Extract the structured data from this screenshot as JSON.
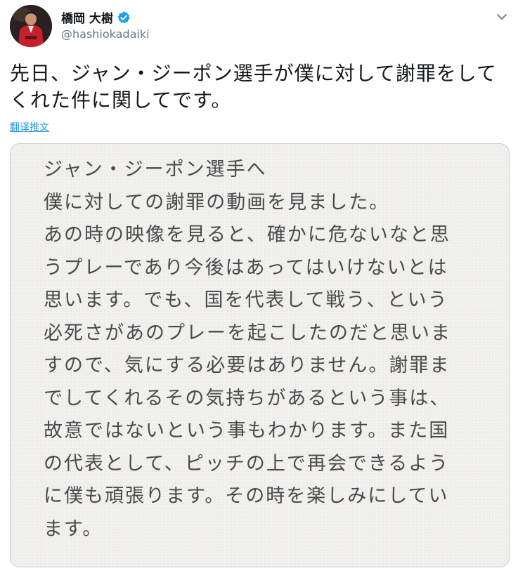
{
  "user": {
    "display_name": "橋岡 大樹",
    "handle": "@hashiokadaiki",
    "verified": true
  },
  "tweet": {
    "text_lines": [
      "先日、ジャン・ジーポン選手が僕に対して謝罪をして",
      "くれた件に関してです。"
    ],
    "translate_label": "翻译推文"
  },
  "image_text": {
    "lines": [
      "ジャン・ジーポン選手へ",
      "僕に対しての謝罪の動画を見ました。",
      "あの時の映像を見ると、確かに危ないなと思",
      "うプレーであり今後はあってはいけないとは",
      "思います。でも、国を代表して戦う、という",
      "必死さがあのプレーを起こしたのだと思いま",
      "すので、気にする必要はありません。謝罪ま",
      "でしてくれるその気持ちがあるという事は、",
      "故意ではないという事もわかります。また国",
      "の代表として、ピッチの上で再会できるよう",
      "に僕も頑張ります。その時を楽しみにしてい",
      "ます。"
    ]
  },
  "icons": {
    "verified": "verified-badge-icon",
    "caret": "chevron-down-icon"
  },
  "colors": {
    "accent": "#1da1f2",
    "link": "#1b95e0",
    "secondary_text": "#657786",
    "card_background": "#f1f0ee"
  }
}
